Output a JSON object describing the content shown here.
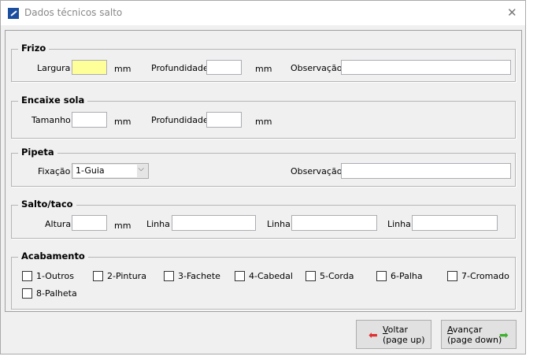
{
  "window": {
    "title": "Dados técnicos salto",
    "close_icon": "close-icon"
  },
  "frizo": {
    "legend": "Frizo",
    "largura_label": "Largura",
    "largura_value": "",
    "largura_unit": "mm",
    "profundidade_label": "Profundidade",
    "profundidade_value": "",
    "profundidade_unit": "mm",
    "observacao_label": "Observação",
    "observacao_value": "",
    "highlight_color": "#ffff99"
  },
  "encaixe": {
    "legend": "Encaixe sola",
    "tamanho_label": "Tamanho",
    "tamanho_value": "",
    "tamanho_unit": "mm",
    "profundidade_label": "Profundidade",
    "profundidade_value": "",
    "profundidade_unit": "mm"
  },
  "pipeta": {
    "legend": "Pipeta",
    "fixacao_label": "Fixação",
    "fixacao_selected": "1-Guia",
    "observacao_label": "Observação",
    "observacao_value": ""
  },
  "salto": {
    "legend": "Salto/taco",
    "altura_label": "Altura",
    "altura_value": "",
    "altura_unit": "mm",
    "linhas": [
      {
        "label": "Linha",
        "value": ""
      },
      {
        "label": "Linha",
        "value": ""
      },
      {
        "label": "Linha",
        "value": ""
      }
    ]
  },
  "acabamento": {
    "legend": "Acabamento",
    "options": [
      {
        "label": "1-Outros",
        "checked": false
      },
      {
        "label": "2-Pintura",
        "checked": false
      },
      {
        "label": "3-Fachete",
        "checked": false
      },
      {
        "label": "4-Cabedal",
        "checked": false
      },
      {
        "label": "5-Corda",
        "checked": false
      },
      {
        "label": "6-Palha",
        "checked": false
      },
      {
        "label": "7-Cromado",
        "checked": false
      },
      {
        "label": "8-Palheta",
        "checked": false
      }
    ]
  },
  "buttons": {
    "voltar_hot": "V",
    "voltar_rest": "oltar",
    "voltar_sub": "(page up)",
    "avancar_hot": "A",
    "avancar_rest": "vançar",
    "avancar_sub": "(page down)"
  }
}
